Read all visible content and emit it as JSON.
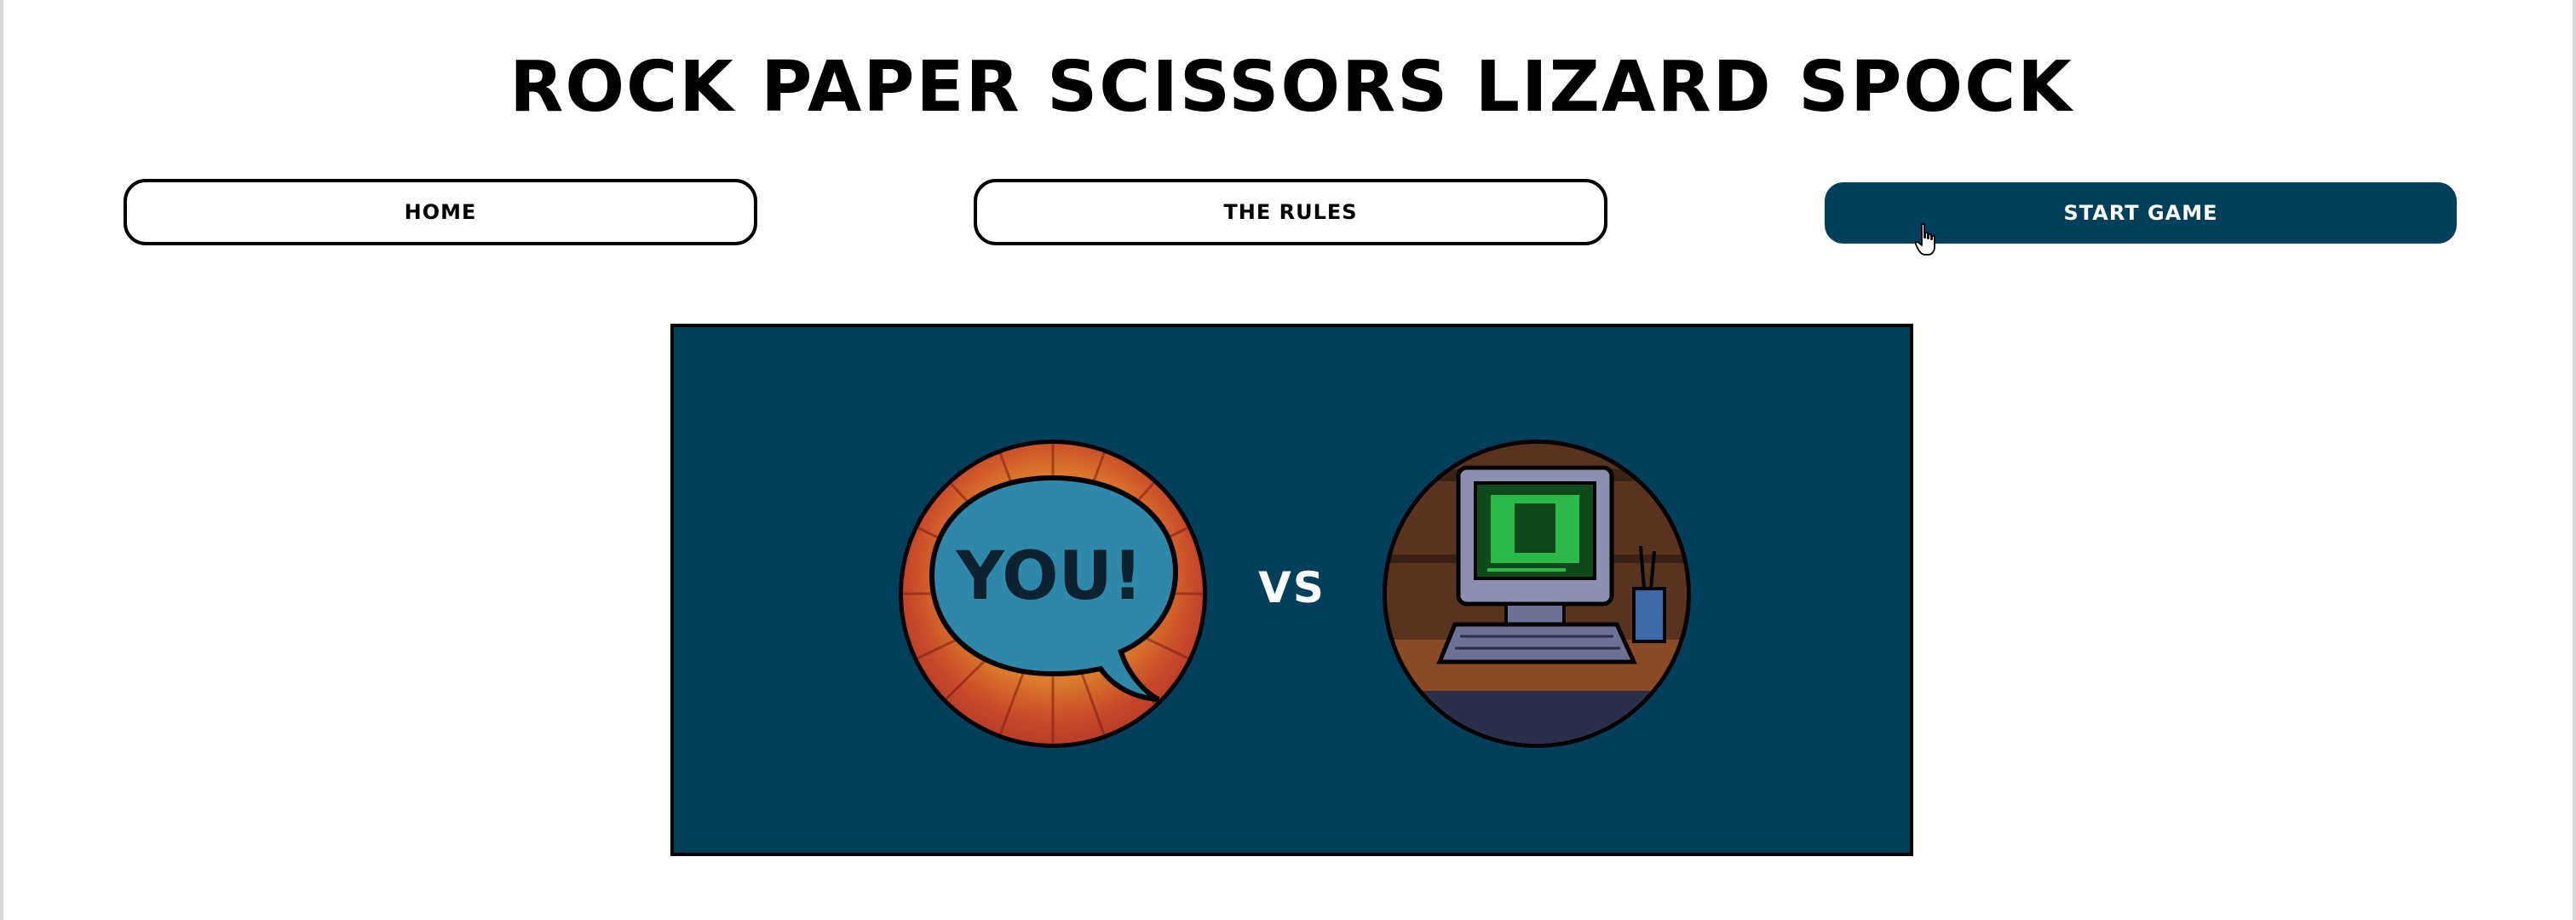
{
  "header": {
    "title": "ROCK PAPER SCISSORS LIZARD SPOCK"
  },
  "nav": {
    "home_label": "HOME",
    "rules_label": "THE RULES",
    "start_label": "START GAME"
  },
  "stage": {
    "player_bubble_text": "YOU!",
    "vs_label": "VS"
  },
  "colors": {
    "accent": "#023f5a",
    "background": "#ffffff",
    "border": "#000000"
  },
  "icons": {
    "player": "speech-bubble-you-icon",
    "computer": "retro-computer-icon",
    "cursor": "hand-pointer-icon"
  }
}
